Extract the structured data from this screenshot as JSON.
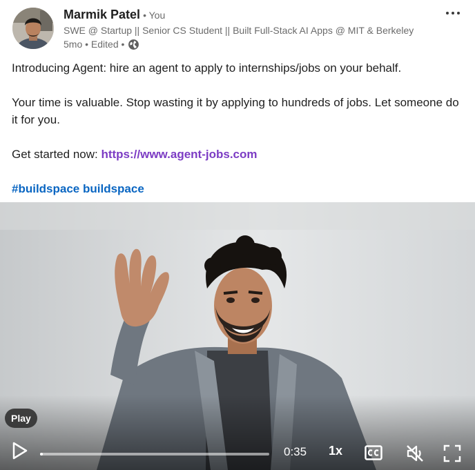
{
  "author": {
    "name": "Marmik Patel",
    "relation": "• You",
    "headline": "SWE @ Startup || Senior CS Student || Built Full-Stack AI Apps @ MIT & Berkeley",
    "meta": "5mo • Edited •",
    "visibility_icon": "globe-icon"
  },
  "menu": {
    "more_label": "···"
  },
  "post": {
    "intro": "Introducing Agent: hire an agent to apply to internships/jobs on your behalf.",
    "body": "Your time is valuable. Stop wasting it by applying to hundreds of jobs. Let someone do it for you.",
    "cta_prefix": "Get started now: ",
    "cta_link": "https://www.agent-jobs.com",
    "hashtag_line": "#buildspace buildspace"
  },
  "video": {
    "tooltip": "Play",
    "time": "0:35",
    "speed": "1x",
    "progress": 0.0,
    "muted": true,
    "icons": [
      "play-icon",
      "closed-captions-icon",
      "muted-speaker-icon",
      "fullscreen-icon"
    ]
  },
  "colors": {
    "link": "#7c3cc4",
    "hashtag": "#0a66c2",
    "meta_text": "#6b6b6b"
  }
}
